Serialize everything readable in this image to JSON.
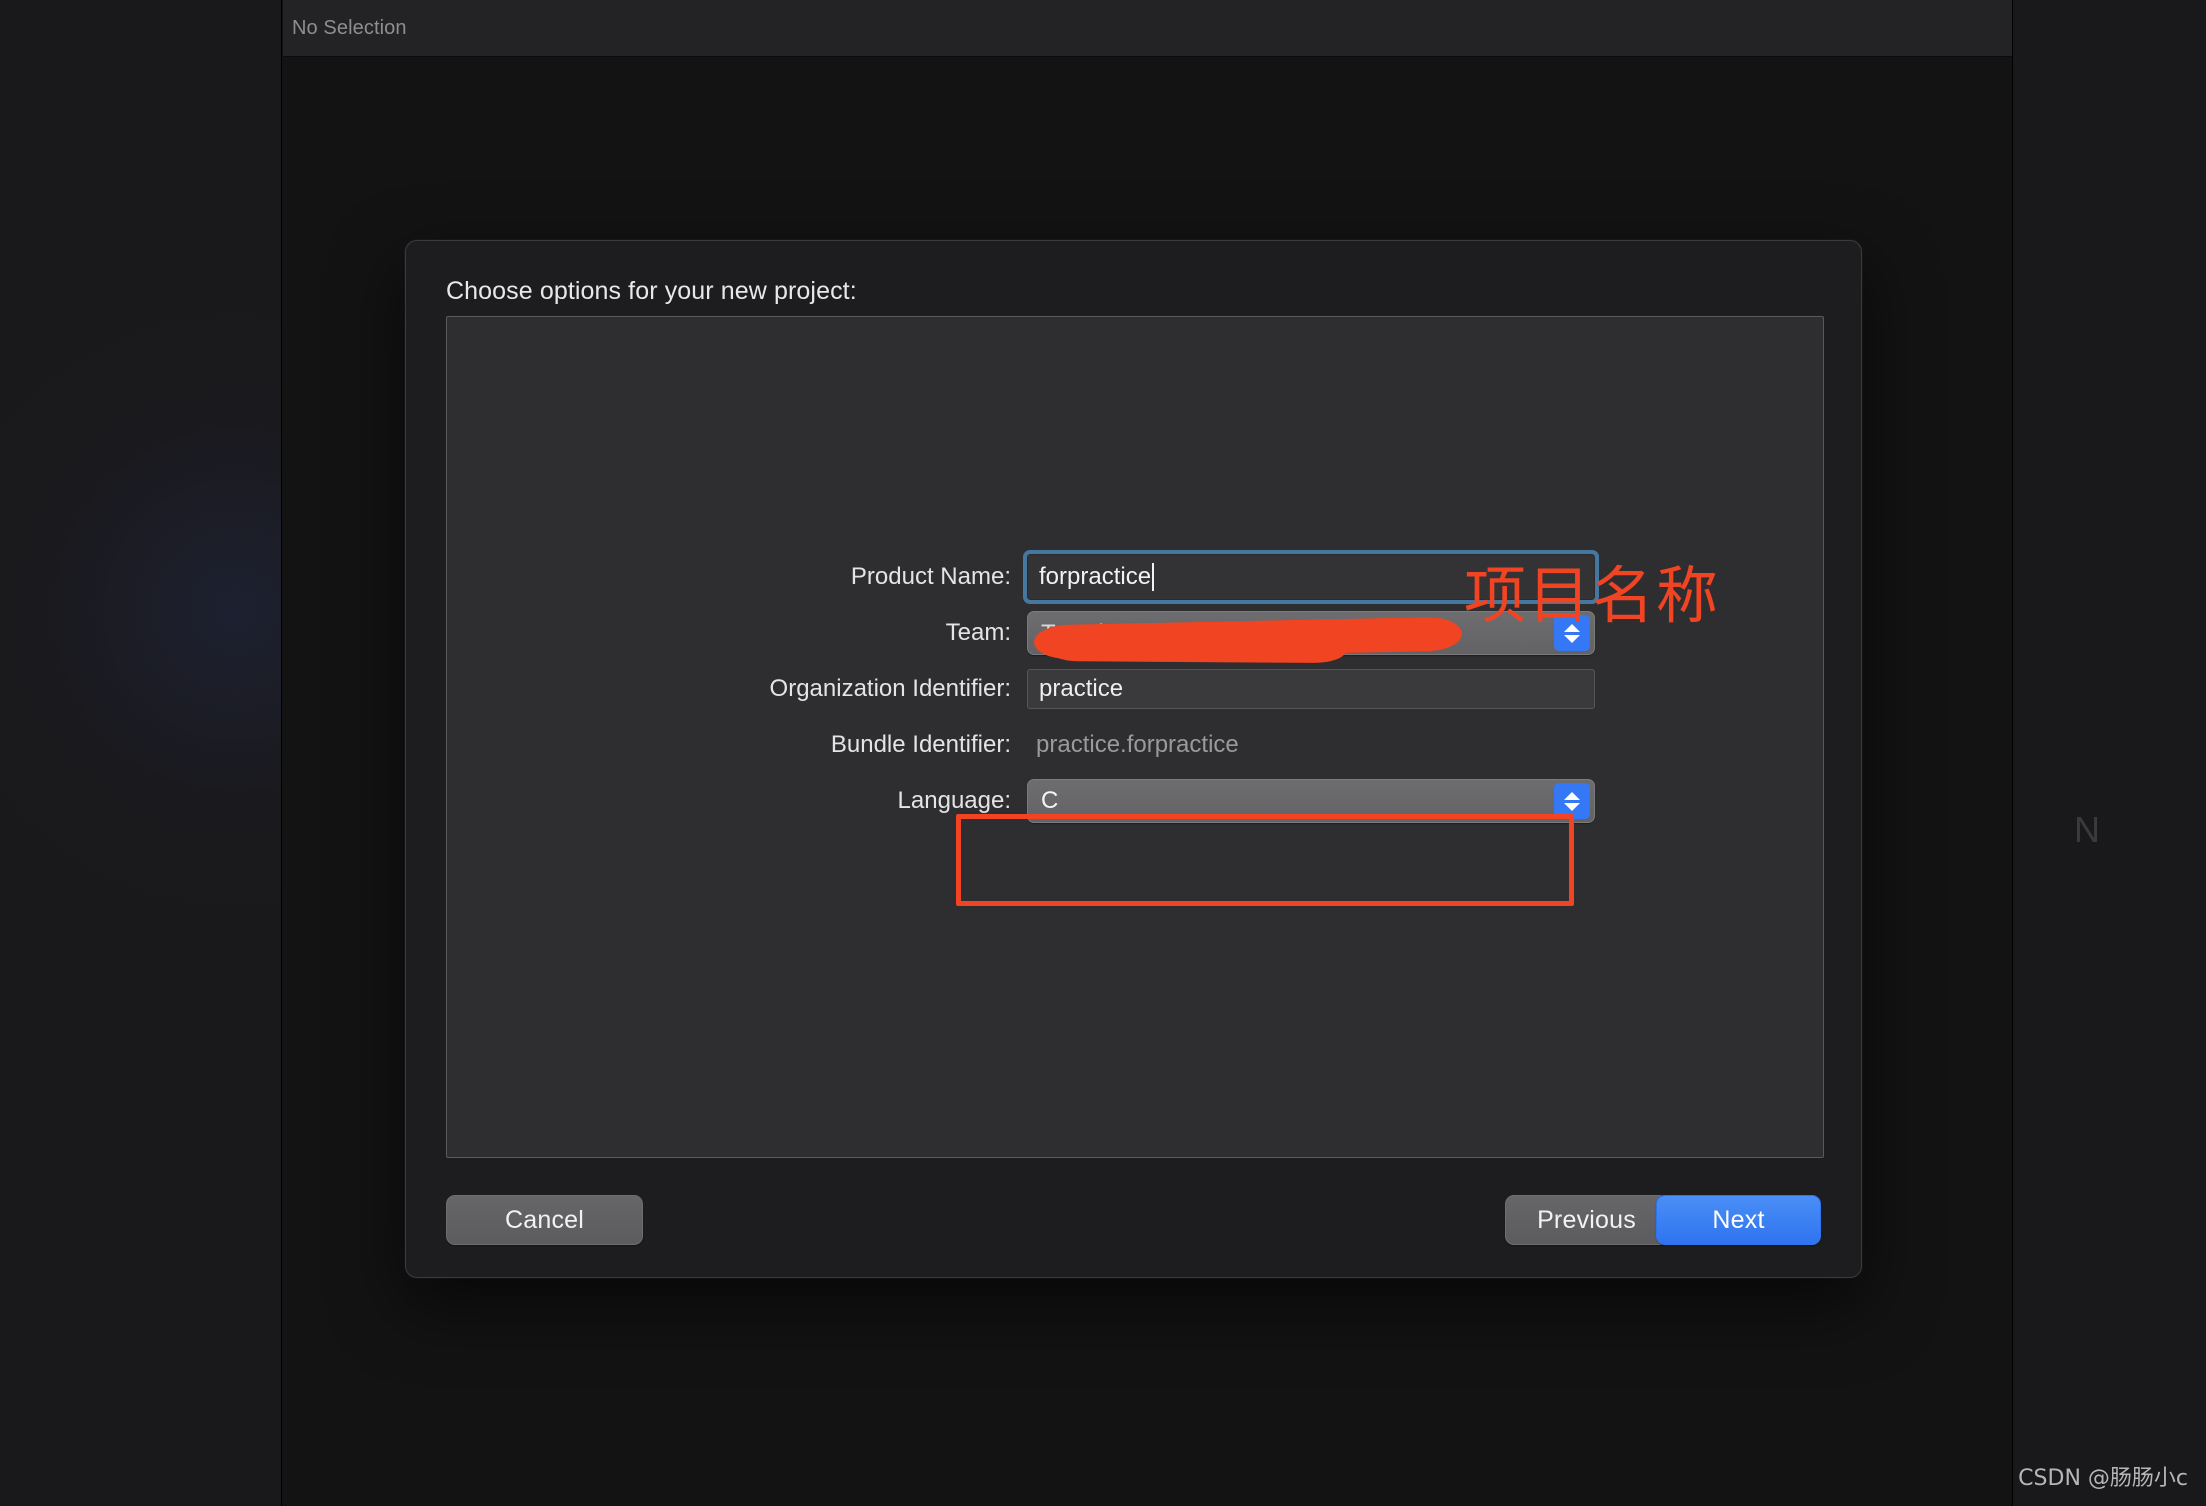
{
  "window": {
    "jump_bar": {
      "no_selection_label": "No Selection"
    },
    "right_pane": {
      "ghost_letter": "N"
    }
  },
  "sheet": {
    "title": "Choose options for your new project:",
    "fields": [
      {
        "label": "Product Name:",
        "type": "text-focused",
        "value": "forpractice"
      },
      {
        "label": "Team:",
        "type": "popup-redacted",
        "value": "Team)",
        "redacted": true
      },
      {
        "label": "Organization Identifier:",
        "type": "text",
        "value": "practice"
      },
      {
        "label": "Bundle Identifier:",
        "type": "static",
        "value": "practice.forpractice"
      },
      {
        "label": "Language:",
        "type": "popup",
        "value": "C"
      }
    ],
    "footer": {
      "cancel_label": "Cancel",
      "previous_label": "Previous",
      "next_label": "Next"
    }
  },
  "annotations": {
    "product_name_note": "项目名称",
    "highlight_color": "#f04423"
  },
  "watermark": {
    "text": "CSDN @肠肠小c"
  },
  "colors": {
    "accent_blue": "#3478f6",
    "focus_ring": "#46779f",
    "annotation_red": "#f04423",
    "sheet_bg": "#1d1d1f",
    "panel_bg": "#2e2e30"
  }
}
